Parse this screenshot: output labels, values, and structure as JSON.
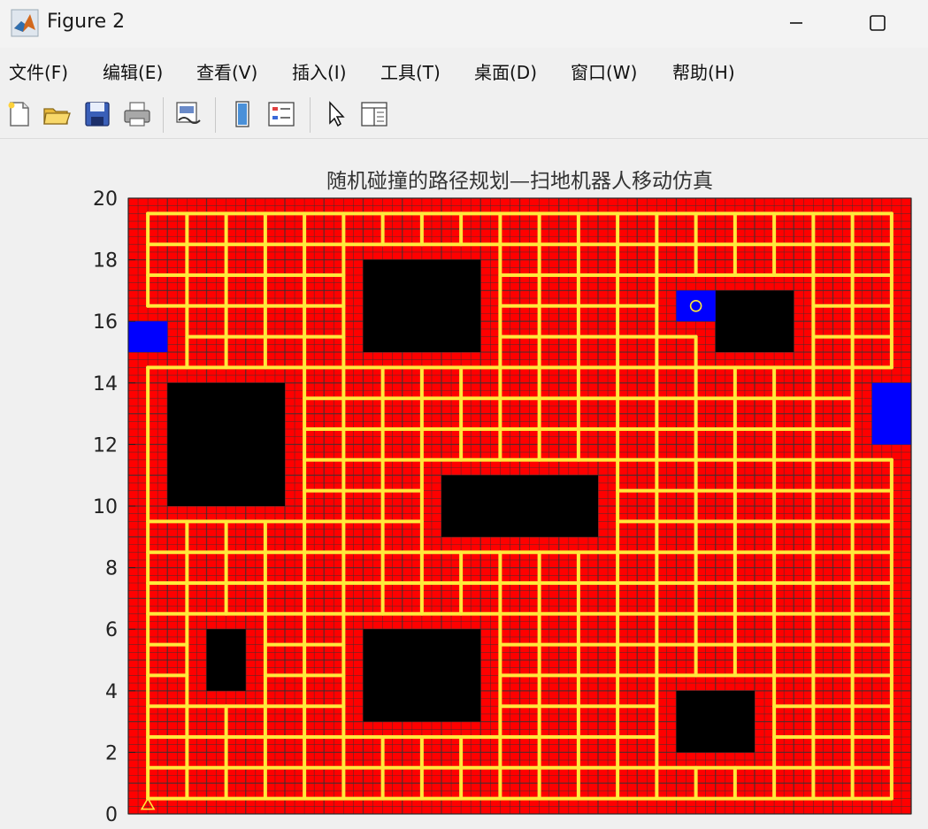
{
  "window": {
    "title": "Figure 2",
    "icon": "matlab-icon",
    "controls": [
      "minimize-icon",
      "maximize-icon"
    ]
  },
  "menu": [
    {
      "label": "文件(F)"
    },
    {
      "label": "编辑(E)"
    },
    {
      "label": "查看(V)"
    },
    {
      "label": "插入(I)"
    },
    {
      "label": "工具(T)"
    },
    {
      "label": "桌面(D)"
    },
    {
      "label": "窗口(W)"
    },
    {
      "label": "帮助(H)"
    }
  ],
  "toolbar": [
    "new-figure-icon",
    "open-file-icon",
    "save-icon",
    "print-icon",
    "link-plot-icon",
    "insert-colorbar-icon",
    "insert-legend-icon",
    "edit-plot-icon",
    "property-inspector-icon"
  ],
  "chart_data": {
    "type": "heatmap",
    "title": "随机碰撞的路径规划—扫地机器人移动仿真",
    "xlim": [
      0,
      20
    ],
    "ylim": [
      0,
      20
    ],
    "yticks": [
      "0",
      "2",
      "4",
      "6",
      "8",
      "10",
      "12",
      "14",
      "16",
      "18",
      "20"
    ],
    "colors": {
      "cleaned": "#ff0000",
      "obstacle": "#000000",
      "blue_cell": "#0000ff",
      "path": "#ffe83a",
      "grid": "#333333",
      "start_marker": "#ffe83a",
      "robot_marker": "#ffe83a"
    },
    "obstacles": [
      {
        "x": [
          1,
          4
        ],
        "y": [
          10,
          14
        ]
      },
      {
        "x": [
          6,
          9
        ],
        "y": [
          15,
          18
        ]
      },
      {
        "x": [
          8,
          12
        ],
        "y": [
          9,
          11
        ]
      },
      {
        "x": [
          15,
          17
        ],
        "y": [
          15,
          17
        ]
      },
      {
        "x": [
          2,
          3
        ],
        "y": [
          4,
          6
        ]
      },
      {
        "x": [
          6,
          9
        ],
        "y": [
          3,
          6
        ]
      },
      {
        "x": [
          14,
          16
        ],
        "y": [
          2,
          4
        ]
      }
    ],
    "blue_cells": [
      {
        "x": [
          0,
          1
        ],
        "y": [
          15,
          16
        ]
      },
      {
        "x": [
          14,
          15
        ],
        "y": [
          16,
          17
        ]
      },
      {
        "x": [
          19,
          20
        ],
        "y": [
          12,
          14
        ]
      }
    ],
    "start_point": [
      0.5,
      0.3
    ],
    "robot_position": [
      14.5,
      16.5
    ]
  }
}
